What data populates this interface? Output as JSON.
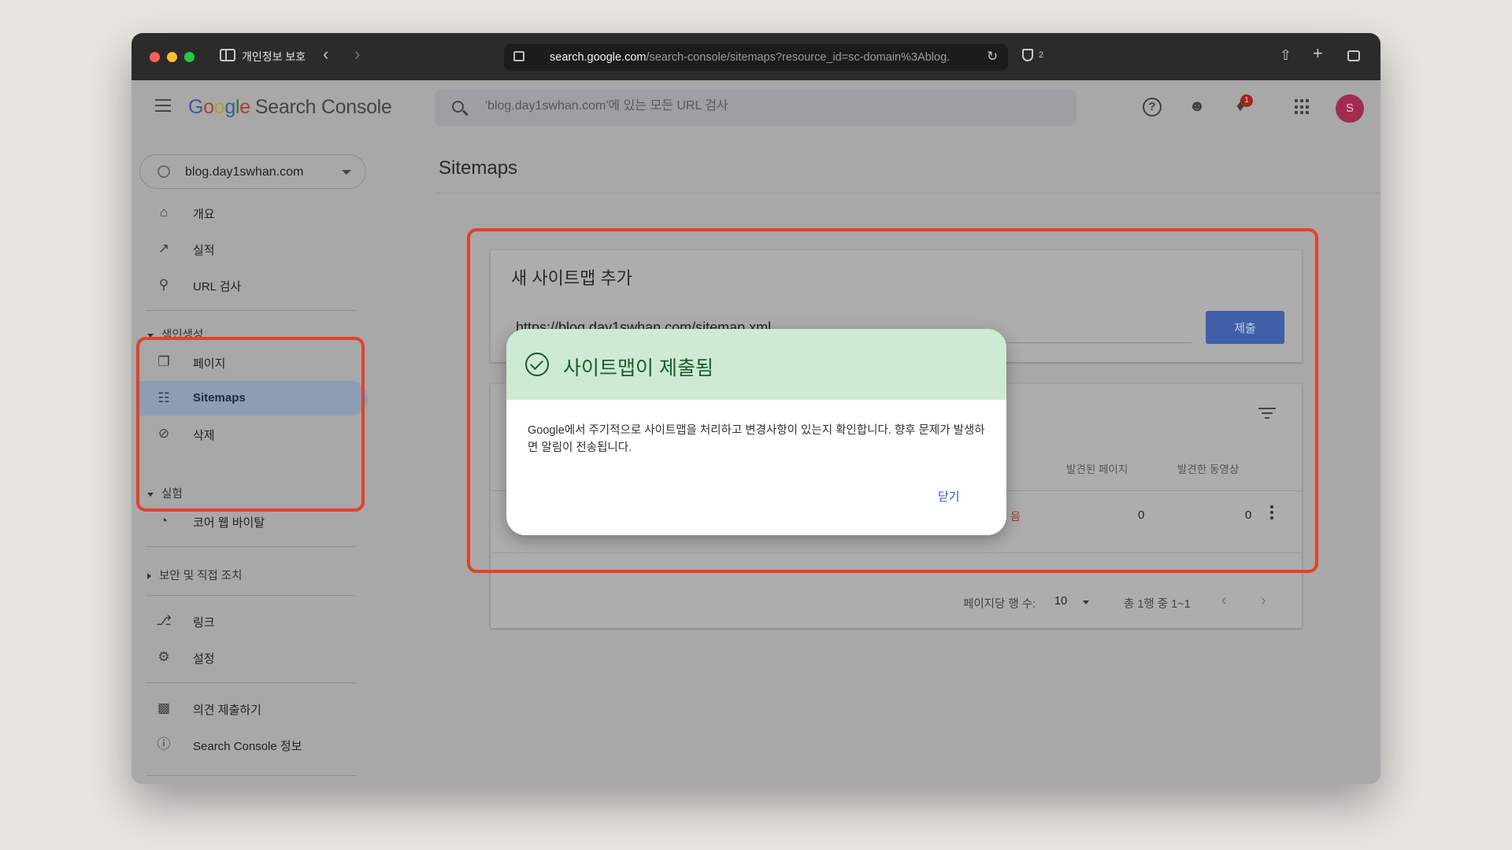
{
  "browser": {
    "privacy_label": "개인정보 보호",
    "url_host": "search.google.com",
    "url_path": "/search-console/sitemaps?resource_id=sc-domain%3Ablog.",
    "shield_count": "2"
  },
  "header": {
    "logo_letters": [
      "G",
      "o",
      "o",
      "g",
      "l",
      "e"
    ],
    "product_name": "Search Console",
    "search_placeholder": "'blog.day1swhan.com'에 있는 모든 URL 검사",
    "notification_count": "1",
    "avatar_initial": "S"
  },
  "sidebar": {
    "property": "blog.day1swhan.com",
    "items_top": [
      {
        "label": "개요",
        "icon": "home-icon"
      },
      {
        "label": "실적",
        "icon": "trending-up-icon"
      },
      {
        "label": "URL 검사",
        "icon": "search-icon"
      }
    ],
    "indexing": {
      "header": "색인생성",
      "items": [
        {
          "label": "페이지",
          "icon": "pages-icon"
        },
        {
          "label": "Sitemaps",
          "icon": "sitemap-icon",
          "active": true
        },
        {
          "label": "삭제",
          "icon": "visibility-off-icon"
        }
      ]
    },
    "experience": {
      "header": "실험",
      "items": [
        {
          "label": "코어 웹 바이탈",
          "icon": "speed-icon"
        }
      ]
    },
    "security": {
      "header": "보안 및 직접 조치"
    },
    "items_bottom": [
      {
        "label": "링크",
        "icon": "links-icon"
      },
      {
        "label": "설정",
        "icon": "settings-icon"
      }
    ],
    "items_footer": [
      {
        "label": "의견 제출하기",
        "icon": "feedback-icon"
      },
      {
        "label": "Search Console 정보",
        "icon": "info-icon"
      }
    ]
  },
  "main": {
    "page_title": "Sitemaps",
    "add_card": {
      "title": "새 사이트맵 추가",
      "input_value": "https://blog.day1swhan.com/sitemap.xml",
      "submit_label": "제출"
    },
    "table": {
      "columns": [
        "발견된 페이지",
        "발견한 동영상"
      ],
      "rows": [
        {
          "status_partial": "음",
          "pages": "0",
          "videos": "0"
        }
      ]
    },
    "pager": {
      "rows_label": "페이지당 행 수:",
      "rows_value": "10",
      "range": "총 1행 중 1~1"
    }
  },
  "dialog": {
    "title": "사이트맵이 제출됨",
    "body": "Google에서 주기적으로 사이트맵을 처리하고 변경사항이 있는지 확인합니다. 향후 문제가 발생하면 알림이 전송됩니다.",
    "close_label": "닫기"
  },
  "colors": {
    "highlight": "#e2412b",
    "accent": "#3f5fa8",
    "success_bg": "#ceead3",
    "success_fg": "#1e5a2c"
  }
}
